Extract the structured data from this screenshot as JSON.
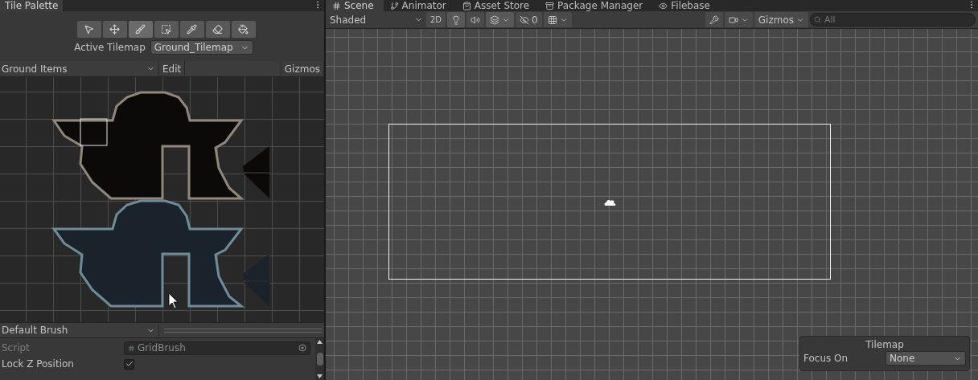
{
  "tile_palette": {
    "title": "Tile Palette",
    "tools": [
      {
        "kind": "select",
        "selected": false
      },
      {
        "kind": "move",
        "selected": false
      },
      {
        "kind": "paint",
        "selected": true
      },
      {
        "kind": "box",
        "selected": false
      },
      {
        "kind": "picker",
        "selected": false
      },
      {
        "kind": "eraser",
        "selected": false
      },
      {
        "kind": "fill",
        "selected": false
      }
    ],
    "active_tilemap": {
      "label": "Active Tilemap",
      "value": "Ground_Tilemap"
    },
    "palette": {
      "value": "Ground Items",
      "edit": "Edit",
      "gizmos": "Gizmos"
    },
    "brush": {
      "value": "Default Brush"
    },
    "inspector": [
      {
        "kind": "object",
        "label": "Script",
        "value": "GridBrush",
        "disabled": true
      },
      {
        "kind": "checkbox",
        "label": "Lock Z Position",
        "checked": true,
        "disabled": false
      }
    ]
  },
  "scene": {
    "tabs": [
      {
        "kind": "scene",
        "label": "Scene",
        "selected": true
      },
      {
        "kind": "animator",
        "label": "Animator",
        "selected": false
      },
      {
        "kind": "store",
        "label": "Asset Store",
        "selected": false
      },
      {
        "kind": "package",
        "label": "Package Manager",
        "selected": false
      },
      {
        "kind": "eye",
        "label": "Filebase",
        "selected": false
      }
    ],
    "toolbar": {
      "shading": "Shaded",
      "mode_2d": "2D",
      "toggles": [
        {
          "kind": "lighting",
          "on": true
        },
        {
          "kind": "audio",
          "on": false
        },
        {
          "kind": "effects",
          "on": true
        },
        {
          "kind": "hidden",
          "on": false,
          "count": "0"
        },
        {
          "kind": "grid",
          "on": false
        }
      ],
      "gizmos": "Gizmos",
      "search_placeholder": "All"
    },
    "overlay": {
      "title": "Tilemap",
      "label": "Focus On",
      "value": "None"
    }
  }
}
